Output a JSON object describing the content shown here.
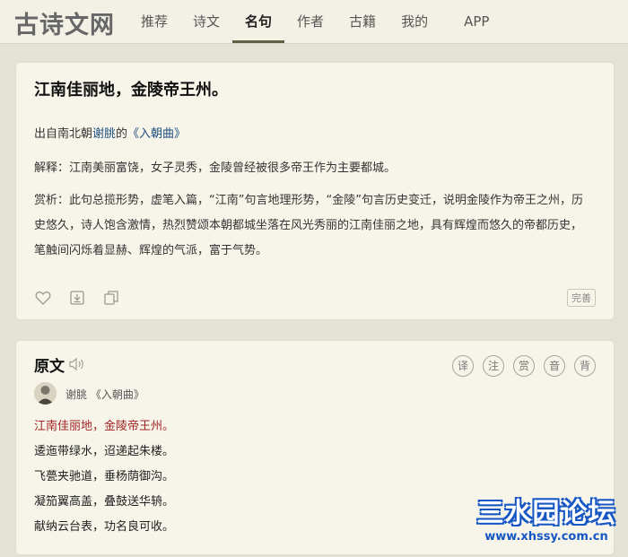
{
  "header": {
    "logo": "古诗文网",
    "nav": [
      {
        "label": "推荐"
      },
      {
        "label": "诗文"
      },
      {
        "label": "名句"
      },
      {
        "label": "作者"
      },
      {
        "label": "古籍"
      },
      {
        "label": "我的"
      },
      {
        "label": "APP"
      }
    ],
    "active_index": 2
  },
  "quote_card": {
    "title": "江南佳丽地，金陵帝王州。",
    "source_prefix": "出自南北朝",
    "source_author": "谢朓",
    "source_mid": "的",
    "source_work": "《入朝曲》",
    "explanation": "解释：江南美丽富饶，女子灵秀，金陵曾经被很多帝王作为主要都城。",
    "appreciation": "赏析：此句总揽形势，虚笔入篇，“江南”句言地理形势，“金陵”句言历史变迁，说明金陵作为帝王之州，历史悠久，诗人饱含激情，热烈赞颂本朝都城坐落在风光秀丽的江南佳丽之地，具有辉煌而悠久的帝都历史，笔触间闪烁着显赫、辉煌的气派，富于气势。",
    "icons": [
      "heart-icon",
      "download-icon",
      "copy-icon"
    ],
    "perfect_label": "完善"
  },
  "original_card": {
    "title": "原文",
    "tools": [
      "译",
      "注",
      "赏",
      "音",
      "背"
    ],
    "author": "谢朓",
    "work": "《入朝曲》",
    "lines": [
      {
        "text": "江南佳丽地，金陵帝王州。",
        "highlight": true
      },
      {
        "text": "逶迤带绿水，迢递起朱楼。",
        "highlight": false
      },
      {
        "text": "飞甍夹驰道，垂杨荫御沟。",
        "highlight": false
      },
      {
        "text": "凝笳翼高盖，叠鼓送华辀。",
        "highlight": false
      },
      {
        "text": "献纳云台表，功名良可收。",
        "highlight": false
      }
    ]
  },
  "watermark": {
    "main": "三水园论坛",
    "url": "www.xhssy.com.cn"
  },
  "colors": {
    "page_bg": "#e4e2d3",
    "card_bg": "#f7f5ea",
    "link": "#1d4d7e",
    "highlight": "#a22323",
    "watermark_blue": "#1556c4"
  }
}
